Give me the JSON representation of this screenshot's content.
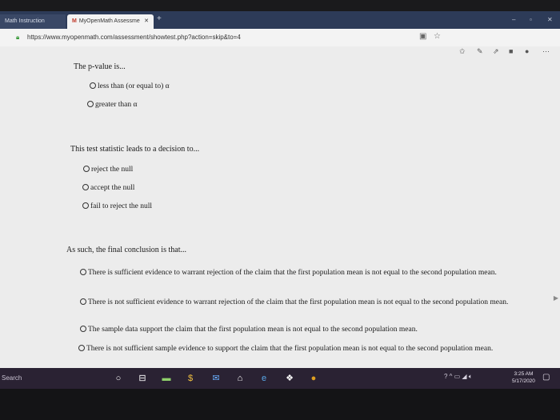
{
  "browser": {
    "tabs": [
      {
        "label": "Math Instruction"
      },
      {
        "label": "MyOpenMath Assessme",
        "logo": "M",
        "close": "✕"
      }
    ],
    "new_tab": "+",
    "url": "https://www.myopenmath.com/assessment/showtest.php?action=skip&to=4"
  },
  "content": {
    "q1": {
      "prompt": "The p-value is...",
      "options": [
        "less than (or equal to) α",
        "greater than α"
      ]
    },
    "q2": {
      "prompt": "This test statistic leads to a decision to...",
      "options": [
        "reject the null",
        "accept the null",
        "fail to reject the null"
      ]
    },
    "q3": {
      "prompt": "As such, the final conclusion is that...",
      "options": [
        "There is sufficient evidence to warrant rejection of the claim that the first population mean is not equal to the second population mean.",
        "There is not sufficient evidence to warrant rejection of the claim that the first population mean is not equal to the second population mean.",
        "The sample data support the claim that the first population mean is not equal to the second population mean.",
        "There is not sufficient sample evidence to support the claim that the first population mean is not equal to the second population mean."
      ]
    }
  },
  "taskbar": {
    "search": "Search",
    "clock_time": "3:25 AM",
    "clock_date": "5/17/2020"
  },
  "icons": [
    "lock-icon",
    "star-icon",
    "cortana-icon",
    "task-view-icon",
    "store-icon",
    "wifi-icon",
    "volume-icon",
    "notification-icon"
  ]
}
